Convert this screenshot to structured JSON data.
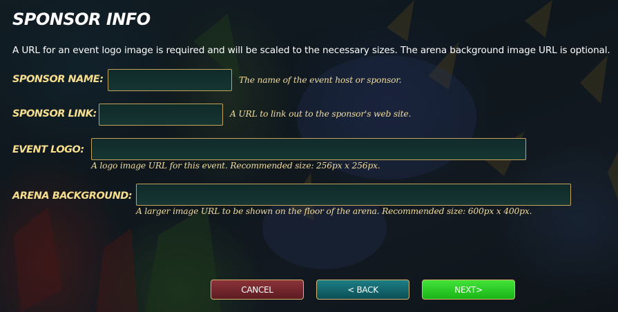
{
  "page": {
    "title": "SPONSOR INFO",
    "description": "A URL for an event logo image is required and will be scaled to the necessary sizes. The arena background image URL is optional."
  },
  "fields": {
    "sponsor_name": {
      "label": "SPONSOR NAME:",
      "value": "",
      "hint": "The name of the event host or sponsor."
    },
    "sponsor_link": {
      "label": "SPONSOR LINK:",
      "value": "",
      "hint": "A URL to link out to the sponsor's web site."
    },
    "event_logo": {
      "label": "EVENT LOGO:",
      "value": "",
      "hint": "A logo image URL for this event. Recommended size: 256px x 256px."
    },
    "arena_background": {
      "label": "ARENA BACKGROUND:",
      "value": "",
      "hint": "A larger image URL to be shown on the floor of the arena. Recommended size: 600px x 400px."
    }
  },
  "buttons": {
    "cancel": "CANCEL",
    "back": "< BACK",
    "next": "NEXT>"
  },
  "colors": {
    "label": "#f6de8e",
    "hint": "#f1dc9c",
    "field_border": "#c8a35a",
    "cancel": "#7a2a30",
    "back": "#146670",
    "next": "#2cc927"
  }
}
